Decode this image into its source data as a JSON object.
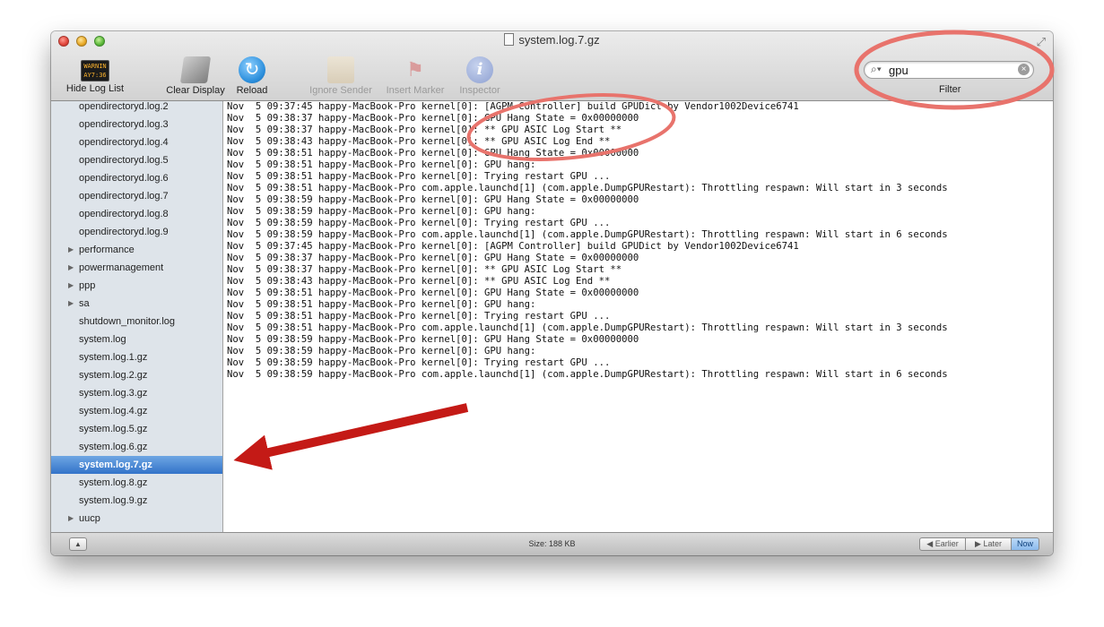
{
  "window": {
    "title": "system.log.7.gz"
  },
  "toolbar": {
    "hide_log_list": "Hide Log List",
    "console_icon_text": "WARNIN\nAY7:36",
    "clear_display": "Clear Display",
    "reload": "Reload",
    "ignore_sender": "Ignore Sender",
    "insert_marker": "Insert Marker",
    "inspector": "Inspector",
    "inspector_glyph": "i",
    "search_value": "gpu",
    "filter_label": "Filter"
  },
  "sidebar": {
    "items": [
      {
        "label": "opendirectoryd.log.2",
        "disclosure": false,
        "selected": false
      },
      {
        "label": "opendirectoryd.log.3",
        "disclosure": false,
        "selected": false
      },
      {
        "label": "opendirectoryd.log.4",
        "disclosure": false,
        "selected": false
      },
      {
        "label": "opendirectoryd.log.5",
        "disclosure": false,
        "selected": false
      },
      {
        "label": "opendirectoryd.log.6",
        "disclosure": false,
        "selected": false
      },
      {
        "label": "opendirectoryd.log.7",
        "disclosure": false,
        "selected": false
      },
      {
        "label": "opendirectoryd.log.8",
        "disclosure": false,
        "selected": false
      },
      {
        "label": "opendirectoryd.log.9",
        "disclosure": false,
        "selected": false
      },
      {
        "label": "performance",
        "disclosure": true,
        "selected": false
      },
      {
        "label": "powermanagement",
        "disclosure": true,
        "selected": false
      },
      {
        "label": "ppp",
        "disclosure": true,
        "selected": false
      },
      {
        "label": "sa",
        "disclosure": true,
        "selected": false
      },
      {
        "label": "shutdown_monitor.log",
        "disclosure": false,
        "selected": false
      },
      {
        "label": "system.log",
        "disclosure": false,
        "selected": false
      },
      {
        "label": "system.log.1.gz",
        "disclosure": false,
        "selected": false
      },
      {
        "label": "system.log.2.gz",
        "disclosure": false,
        "selected": false
      },
      {
        "label": "system.log.3.gz",
        "disclosure": false,
        "selected": false
      },
      {
        "label": "system.log.4.gz",
        "disclosure": false,
        "selected": false
      },
      {
        "label": "system.log.5.gz",
        "disclosure": false,
        "selected": false
      },
      {
        "label": "system.log.6.gz",
        "disclosure": false,
        "selected": false
      },
      {
        "label": "system.log.7.gz",
        "disclosure": false,
        "selected": true
      },
      {
        "label": "system.log.8.gz",
        "disclosure": false,
        "selected": false
      },
      {
        "label": "system.log.9.gz",
        "disclosure": false,
        "selected": false
      },
      {
        "label": "uucp",
        "disclosure": true,
        "selected": false
      }
    ]
  },
  "log_lines": [
    "Nov  5 09:37:45 happy-MacBook-Pro kernel[0]: [AGPM Controller] build GPUDict by Vendor1002Device6741",
    "Nov  5 09:38:37 happy-MacBook-Pro kernel[0]: GPU Hang State = 0x00000000",
    "Nov  5 09:38:37 happy-MacBook-Pro kernel[0]: ** GPU ASIC Log Start **",
    "Nov  5 09:38:43 happy-MacBook-Pro kernel[0]: ** GPU ASIC Log End **",
    "Nov  5 09:38:51 happy-MacBook-Pro kernel[0]: GPU Hang State = 0x00000000",
    "Nov  5 09:38:51 happy-MacBook-Pro kernel[0]: GPU hang:",
    "Nov  5 09:38:51 happy-MacBook-Pro kernel[0]: Trying restart GPU ...",
    "Nov  5 09:38:51 happy-MacBook-Pro com.apple.launchd[1] (com.apple.DumpGPURestart): Throttling respawn: Will start in 3 seconds",
    "Nov  5 09:38:59 happy-MacBook-Pro kernel[0]: GPU Hang State = 0x00000000",
    "Nov  5 09:38:59 happy-MacBook-Pro kernel[0]: GPU hang:",
    "Nov  5 09:38:59 happy-MacBook-Pro kernel[0]: Trying restart GPU ...",
    "Nov  5 09:38:59 happy-MacBook-Pro com.apple.launchd[1] (com.apple.DumpGPURestart): Throttling respawn: Will start in 6 seconds",
    "Nov  5 09:37:45 happy-MacBook-Pro kernel[0]: [AGPM Controller] build GPUDict by Vendor1002Device6741",
    "Nov  5 09:38:37 happy-MacBook-Pro kernel[0]: GPU Hang State = 0x00000000",
    "Nov  5 09:38:37 happy-MacBook-Pro kernel[0]: ** GPU ASIC Log Start **",
    "Nov  5 09:38:43 happy-MacBook-Pro kernel[0]: ** GPU ASIC Log End **",
    "Nov  5 09:38:51 happy-MacBook-Pro kernel[0]: GPU Hang State = 0x00000000",
    "Nov  5 09:38:51 happy-MacBook-Pro kernel[0]: GPU hang:",
    "Nov  5 09:38:51 happy-MacBook-Pro kernel[0]: Trying restart GPU ...",
    "Nov  5 09:38:51 happy-MacBook-Pro com.apple.launchd[1] (com.apple.DumpGPURestart): Throttling respawn: Will start in 3 seconds",
    "Nov  5 09:38:59 happy-MacBook-Pro kernel[0]: GPU Hang State = 0x00000000",
    "Nov  5 09:38:59 happy-MacBook-Pro kernel[0]: GPU hang:",
    "Nov  5 09:38:59 happy-MacBook-Pro kernel[0]: Trying restart GPU ...",
    "Nov  5 09:38:59 happy-MacBook-Pro com.apple.launchd[1] (com.apple.DumpGPURestart): Throttling respawn: Will start in 6 seconds"
  ],
  "statusbar": {
    "size": "Size: 188 KB",
    "earlier": "Earlier",
    "later": "Later",
    "now": "Now"
  },
  "annotations": {
    "highlight_color": "#e8736c",
    "arrow_color": "#c41a16"
  },
  "icons": {
    "toggle": "sidebar-toggle-icon",
    "search": "search-icon",
    "clear": "clear-search-icon",
    "reload": "reload-icon",
    "marker": "flag-icon",
    "inspector": "info-icon"
  }
}
